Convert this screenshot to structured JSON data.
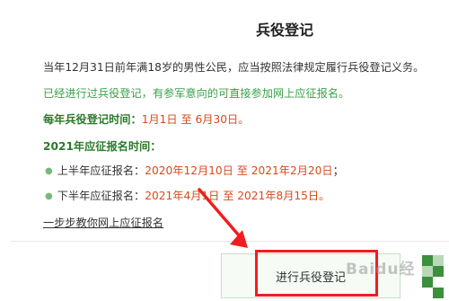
{
  "title": "兵役登记",
  "intro": "当年12月31日前年满18岁的男性公民，应当按照法律规定履行兵役登记义务。",
  "notice": "已经进行过兵役登记，有参军意向的可直接参加网上应征报名。",
  "annual": {
    "label": "每年兵役登记时间：",
    "start": "1月1日",
    "sep": "至",
    "end": "6月30日。"
  },
  "heading_2021": "2021年应征报名时间：",
  "first_half": {
    "label": "上半年应征报名：",
    "start": "2020年12月10日",
    "sep": "至",
    "end": "2021年2月20日",
    "tail": "；"
  },
  "second_half": {
    "label": "下半年应征报名：",
    "start": "2021年4月1日",
    "sep": "至",
    "end": "2021年8月15日。"
  },
  "guide_link": "一步步教你网上应征报名",
  "action_button": "进行兵役登记",
  "watermark": "Baidu经验",
  "colors": {
    "accent_green": "#3aa14a",
    "date_red": "#d84a1b",
    "highlight_red": "#f01e1e"
  }
}
